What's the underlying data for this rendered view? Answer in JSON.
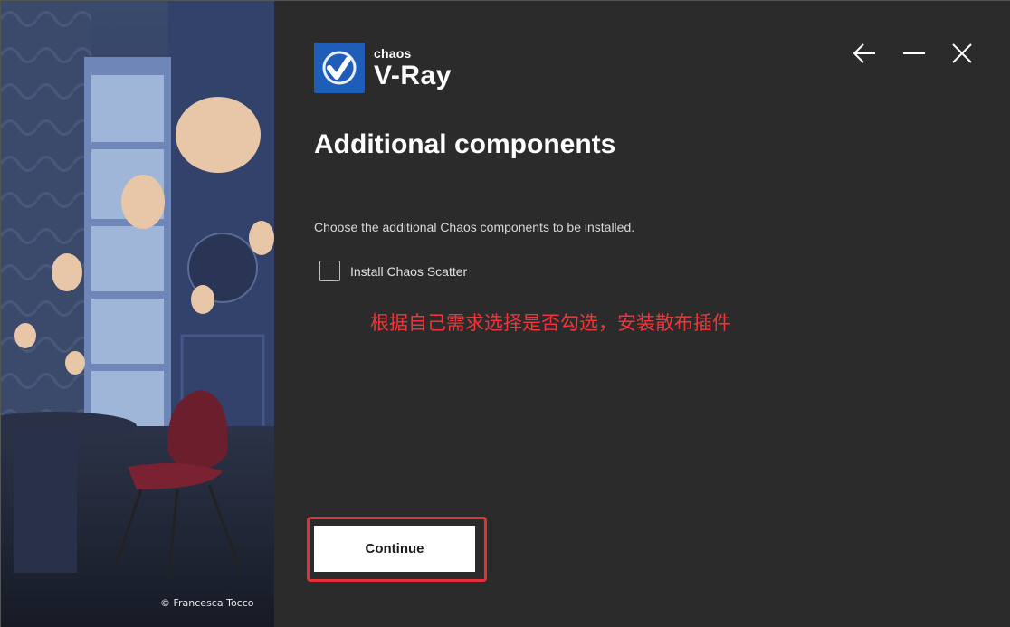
{
  "brand": {
    "small": "chaos",
    "name": "V-Ray",
    "logo_color": "#1f5eb8"
  },
  "window_controls": {
    "back_icon": "arrow-left-icon",
    "minimize_icon": "minimize-icon",
    "close_icon": "close-icon"
  },
  "page": {
    "title": "Additional components",
    "subtitle": "Choose the additional Chaos components to be installed."
  },
  "options": [
    {
      "label": "Install Chaos Scatter",
      "checked": false
    }
  ],
  "annotation": {
    "text": "根据自己需求选择是否勾选，安装散布插件",
    "color": "#f0353a"
  },
  "buttons": {
    "continue": "Continue"
  },
  "artwork": {
    "credit": "© Francesca Tocco"
  },
  "colors": {
    "background": "#2b2b2b",
    "accent_highlight": "#e3303a"
  }
}
